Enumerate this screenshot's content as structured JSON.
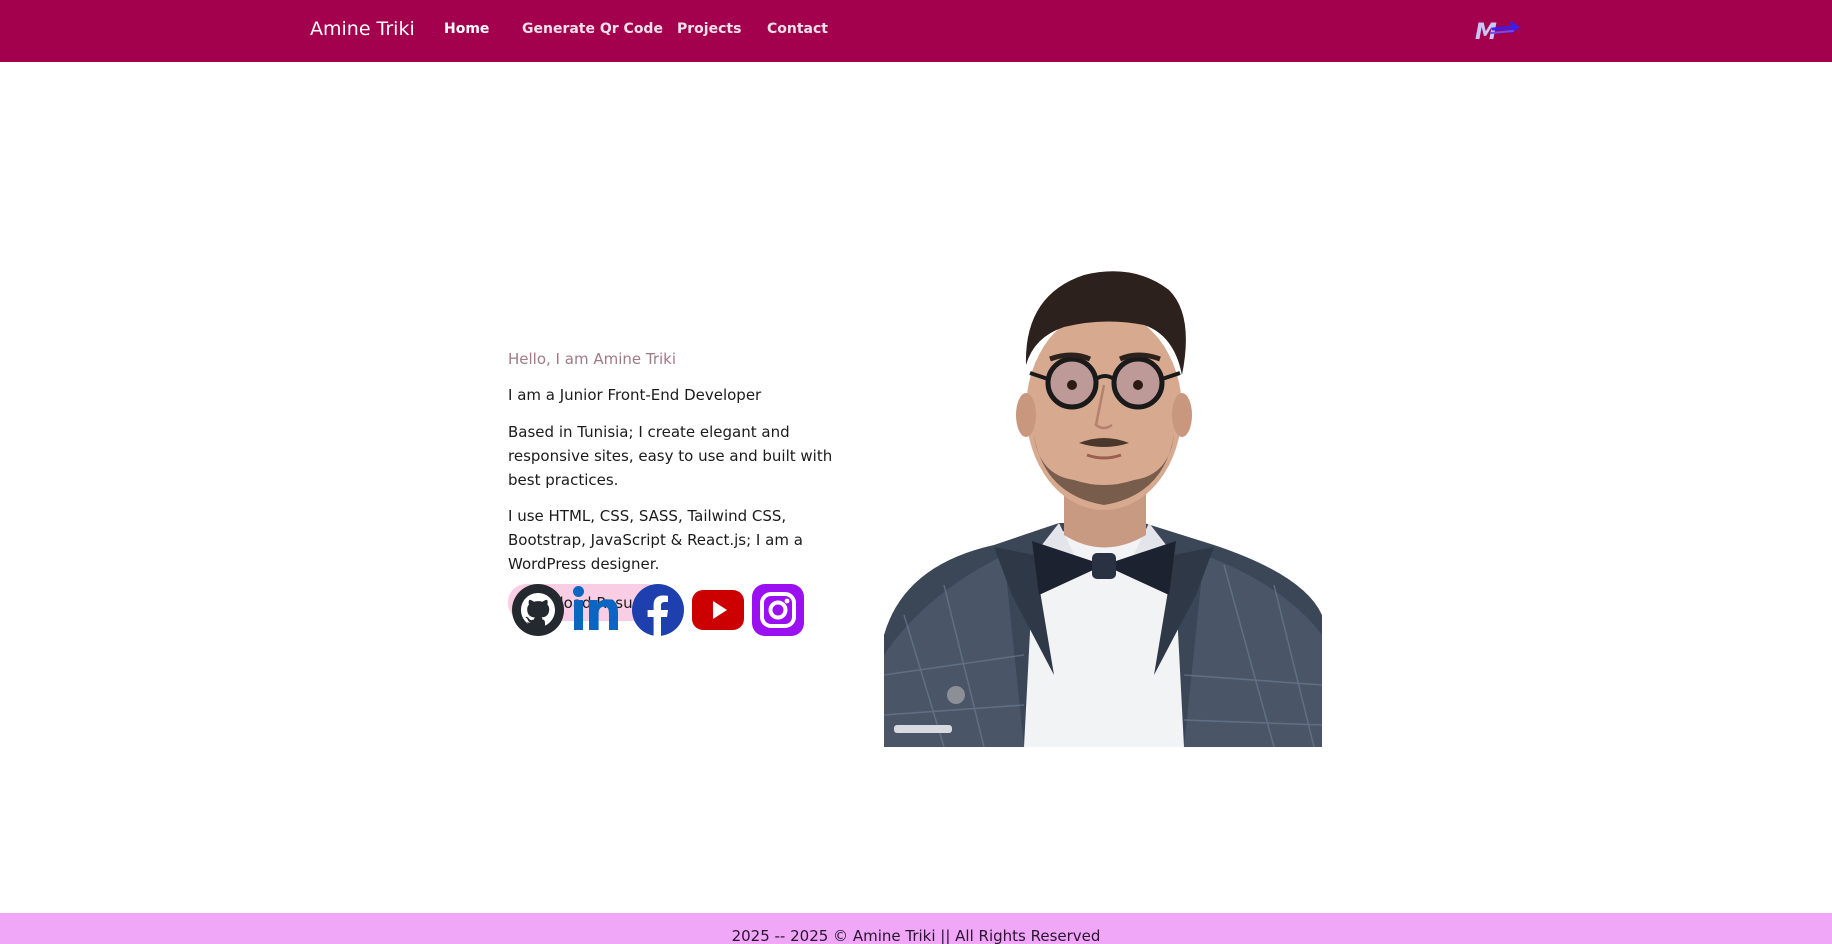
{
  "navbar": {
    "brand": "Amine Triki",
    "links": [
      {
        "label": "Home",
        "active": true
      },
      {
        "label": "Generate Qr Code",
        "active": false
      },
      {
        "label": "Projects",
        "active": false
      },
      {
        "label": "Contact",
        "active": false
      }
    ],
    "logo_text": "M",
    "background": "#a3004d"
  },
  "hero": {
    "greeting": "Hello, I am Amine Triki",
    "role": "I am a Junior Front-End Developer",
    "paragraph_1": "Based in Tunisia; I create elegant and responsive sites, easy to use and built with best practices.",
    "paragraph_2": "I use HTML, CSS, SASS, Tailwind CSS, Bootstrap, JavaScript & React.js; I am a WordPress designer.",
    "resume_button": "Download Resume",
    "button_color": "#f9cde4"
  },
  "socials": [
    {
      "icon": "github-icon",
      "color": "#24292f"
    },
    {
      "icon": "linkedin-icon",
      "color": "#0a66c2"
    },
    {
      "icon": "facebook-icon",
      "color": "#1877f2"
    },
    {
      "icon": "youtube-icon",
      "color": "#cc0000"
    },
    {
      "icon": "instagram-icon",
      "color": "#9b10f0"
    }
  ],
  "portrait": {
    "icon": "profile-photo"
  },
  "footer": {
    "text": "2025 -- 2025 © Amine Triki || All Rights Reserved",
    "background": "#f0a7f8"
  }
}
